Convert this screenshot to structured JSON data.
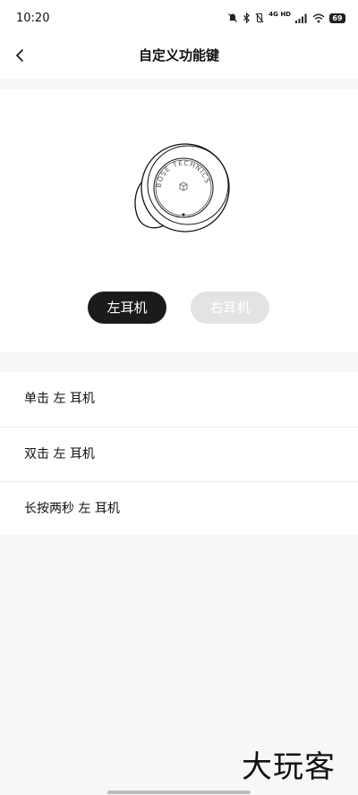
{
  "status_bar": {
    "time": "10:20",
    "network_label": "4G HD",
    "battery_level": "69",
    "icons": [
      "mute-icon",
      "bluetooth-icon",
      "vibrate-icon",
      "signal-icon",
      "wifi-icon",
      "battery-icon"
    ]
  },
  "header": {
    "back_icon": "chevron-left-icon",
    "title": "自定义功能键"
  },
  "earbud": {
    "brand_text": "BOSE TECHNICS CERAMICS",
    "icon": "earbud-illustration"
  },
  "toggle": {
    "left_label": "左耳机",
    "right_label": "右耳机",
    "selected": "左耳机"
  },
  "actions": {
    "items": [
      {
        "label": "单击 左 耳机"
      },
      {
        "label": "双击 左 耳机"
      },
      {
        "label": "长按两秒 左 耳机"
      }
    ]
  },
  "watermark": {
    "text": "大玩客"
  },
  "colors": {
    "selected_toggle_bg": "#1b1b1b",
    "unselected_toggle_bg": "#e3e3e3",
    "page_bg": "#f7f7f7",
    "card_bg": "#ffffff"
  }
}
